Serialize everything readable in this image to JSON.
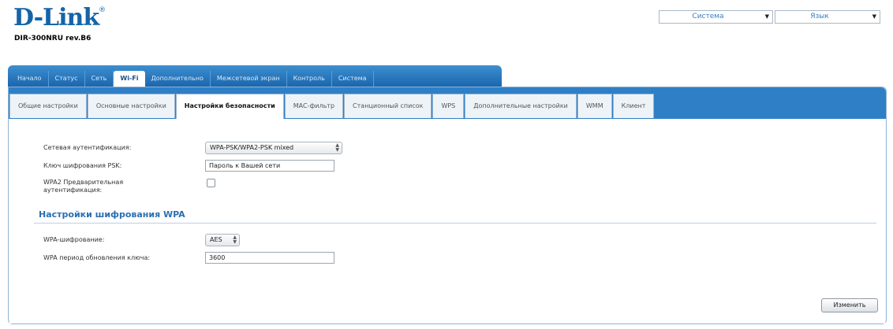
{
  "brand": {
    "logo": "D-Link",
    "model": "DIR-300NRU rev.B6"
  },
  "header": {
    "system_select": "Система",
    "language_select": "Язык"
  },
  "topnav": [
    "Начало",
    "Статус",
    "Сеть",
    "Wi-Fi",
    "Дополнительно",
    "Межсетевой экран",
    "Контроль",
    "Система"
  ],
  "topnav_active": "Wi-Fi",
  "subnav": [
    "Общие настройки",
    "Основные настройки",
    "Настройки безопасности",
    "MAC-фильтр",
    "Станционный список",
    "WPS",
    "Дополнительные настройки",
    "WMM",
    "Клиент"
  ],
  "subnav_active": "Настройки безопасности",
  "form": {
    "auth_label": "Сетевая аутентификация:",
    "auth_value": "WPA-PSK/WPA2-PSK mixed",
    "psk_label": "Ключ шифрования PSK:",
    "psk_value": "Пароль к Вашей сети",
    "preauth_label_1": "WPA2 Предварительная",
    "preauth_label_2": "аутентификация:",
    "preauth_checked": false
  },
  "wpa": {
    "title": "Настройки шифрования WPA",
    "cipher_label": "WPA-шифрование:",
    "cipher_value": "AES",
    "rekey_label": "WPA период обновления ключа:",
    "rekey_value": "3600"
  },
  "apply_label": "Изменить",
  "colors": {
    "brand_blue": "#1464a8",
    "nav_blue": "#2f7fc6",
    "section_blue": "#2a6fb1"
  }
}
